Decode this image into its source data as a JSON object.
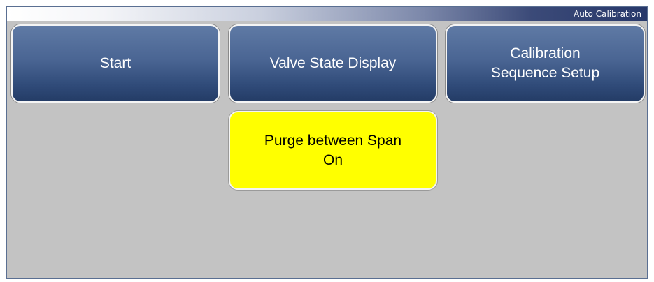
{
  "title_bar": {
    "title": "Auto Calibration"
  },
  "buttons": {
    "start": "Start",
    "valve_state_display": "Valve State Display",
    "calibration_sequence_setup_line1": "Calibration",
    "calibration_sequence_setup_line2": "Sequence Setup",
    "purge_between_span_line1": "Purge between Span",
    "purge_between_span_line2": "On"
  },
  "colors": {
    "button_blue": "#4a6593",
    "button_yellow": "#ffff00",
    "background": "#c3c3c3"
  }
}
